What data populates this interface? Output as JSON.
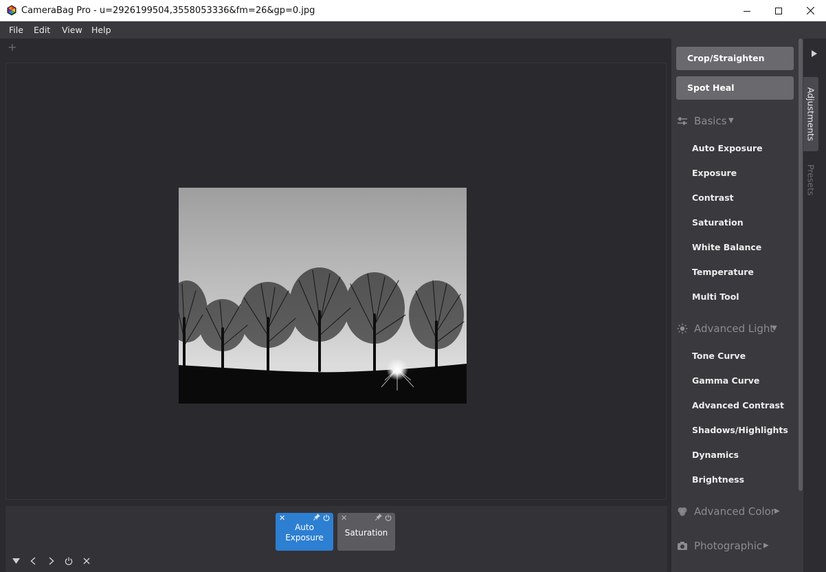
{
  "window": {
    "title": "CameraBag Pro - u=2926199504,3558053336&fm=26&gp=0.jpg"
  },
  "menu": [
    "File",
    "Edit",
    "View",
    "Help"
  ],
  "canvas": {
    "add_symbol": "+"
  },
  "tools": {
    "crop": "Crop/Straighten",
    "heal": "Spot Heal"
  },
  "sections": {
    "basics": {
      "title": "Basics",
      "items": [
        "Auto Exposure",
        "Exposure",
        "Contrast",
        "Saturation",
        "White Balance",
        "Temperature",
        "Multi Tool"
      ]
    },
    "advanced_light": {
      "title": "Advanced Light",
      "items": [
        "Tone Curve",
        "Gamma Curve",
        "Advanced Contrast",
        "Shadows/Highlights",
        "Dynamics",
        "Brightness"
      ]
    },
    "advanced_color": {
      "title": "Advanced Color"
    },
    "photographic": {
      "title": "Photographic"
    }
  },
  "stack": {
    "chips": [
      {
        "label": "Auto Exposure",
        "active": true,
        "color": "#2d7fd2"
      },
      {
        "label": "Saturation",
        "active": false,
        "color": "#5c5b60"
      }
    ]
  },
  "side_tabs": [
    "Adjustments",
    "Presets"
  ],
  "colors": {
    "accent": "#2d7fd2",
    "panel_bg": "#3a393e",
    "canvas_bg": "#2b2a2e"
  },
  "icons": {
    "window": [
      "minimize-icon",
      "maximize-icon",
      "close-icon"
    ],
    "bottom": [
      "collapse-down-icon",
      "previous-icon",
      "next-icon",
      "power-icon",
      "close-icon"
    ]
  }
}
